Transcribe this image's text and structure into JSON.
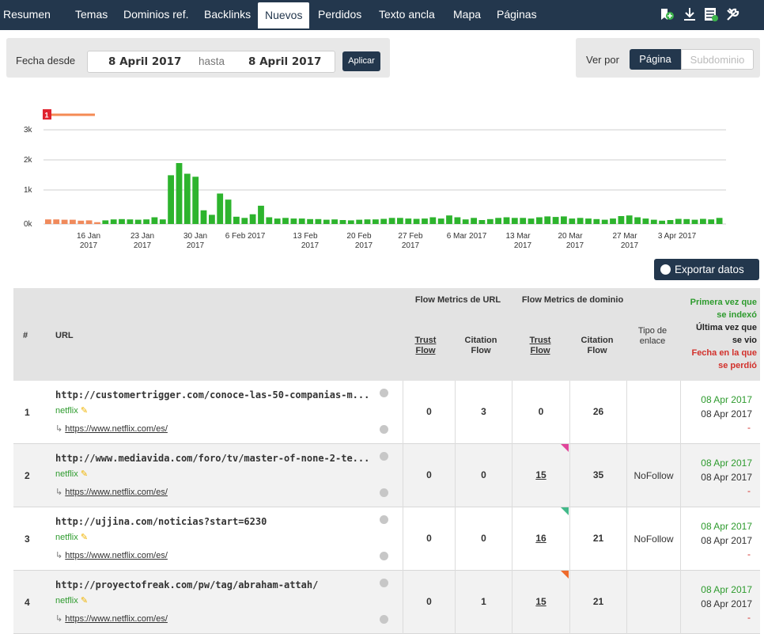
{
  "nav": {
    "tabs": [
      "Resumen",
      "Temas",
      "Dominios ref.",
      "Backlinks",
      "Nuevos",
      "Perdidos",
      "Texto ancla",
      "Mapa",
      "Páginas"
    ],
    "active": "Nuevos",
    "icons": [
      "bookmark-add-icon",
      "download-icon",
      "export-sheet-icon",
      "tools-icon"
    ]
  },
  "filter": {
    "label": "Fecha desde",
    "from": "8 April 2017",
    "to_label": "hasta",
    "to": "8 April 2017",
    "apply": "Aplicar"
  },
  "view": {
    "label": "Ver por",
    "selected": "Página",
    "other": "Subdominio"
  },
  "chart_data": {
    "type": "bar",
    "yticks": [
      "3k",
      "2k",
      "1k",
      "0k"
    ],
    "ylim": [
      0,
      3500
    ],
    "x_labels": [
      {
        "l1": "16 Jan",
        "l2": "2017"
      },
      {
        "l1": "23 Jan",
        "l2": "2017"
      },
      {
        "l1": "30 Jan",
        "l2": "2017"
      },
      {
        "l1": "6 Feb 2017",
        "l2": ""
      },
      {
        "l1": "13 Feb",
        "l2": "2017"
      },
      {
        "l1": "20 Feb",
        "l2": "2017"
      },
      {
        "l1": "27 Feb",
        "l2": "2017"
      },
      {
        "l1": "6 Mar 2017",
        "l2": ""
      },
      {
        "l1": "13 Mar",
        "l2": "2017"
      },
      {
        "l1": "20 Mar",
        "l2": "2017"
      },
      {
        "l1": "27 Mar",
        "l2": "2017"
      },
      {
        "l1": "3 Apr 2017",
        "l2": ""
      }
    ],
    "values": [
      150,
      150,
      140,
      140,
      110,
      120,
      60,
      120,
      150,
      160,
      150,
      140,
      150,
      220,
      150,
      1600,
      2000,
      1650,
      1550,
      450,
      300,
      1000,
      800,
      240,
      200,
      320,
      600,
      220,
      180,
      200,
      180,
      180,
      160,
      160,
      140,
      150,
      130,
      120,
      140,
      150,
      150,
      170,
      200,
      200,
      180,
      170,
      180,
      220,
      180,
      280,
      220,
      150,
      200,
      130,
      160,
      200,
      220,
      200,
      200,
      180,
      220,
      250,
      230,
      250,
      180,
      200,
      180,
      160,
      140,
      180,
      260,
      280,
      220,
      180,
      140,
      110,
      130,
      170,
      160,
      140,
      170,
      150,
      200
    ],
    "bar_colors": {
      "start": "#f08a5c",
      "main": "#2db42d"
    },
    "orange_count": 7,
    "legend_badge": "1",
    "legend_badge_color": "#e0232e",
    "legend_line_color": "#f48a54"
  },
  "export": {
    "label": "Exportar datos"
  },
  "table": {
    "headers": {
      "num": "#",
      "url": "URL",
      "fm_url": "Flow Metrics de URL",
      "fm_dom": "Flow Metrics de dominio",
      "tf1_a": "Trust",
      "tf1_b": "Flow",
      "cf1_a": "Citation",
      "cf1_b": "Flow",
      "tf2_a": "Trust",
      "tf2_b": "Flow",
      "cf2_a": "Citation",
      "cf2_b": "Flow",
      "tipo_a": "Tipo de",
      "tipo_b": "enlace",
      "d1_a": "Primera vez que",
      "d1_b": "se indexó",
      "d2_a": "Última vez que",
      "d2_b": "se vio",
      "d3_a": "Fecha en la que",
      "d3_b": "se perdió"
    },
    "rows": [
      {
        "n": "1",
        "url": "http://customertrigger.com/conoce-las-50-companias-m...",
        "anchor": "netflix",
        "target": "https://www.netflix.com/es/",
        "tf": "0",
        "cf": "3",
        "dtf": "0",
        "dcf": "26",
        "type": "",
        "first": "08 Apr 2017",
        "last": "08 Apr 2017",
        "lost": "-",
        "flag": ""
      },
      {
        "n": "2",
        "url": "http://www.mediavida.com/foro/tv/master-of-none-2-te...",
        "anchor": "netflix",
        "target": "https://www.netflix.com/es/",
        "tf": "0",
        "cf": "0",
        "dtf": "15",
        "dcf": "35",
        "type": "NoFollow",
        "first": "08 Apr 2017",
        "last": "08 Apr 2017",
        "lost": "-",
        "flag": "#e0459a"
      },
      {
        "n": "3",
        "url": "http://ujjina.com/noticias?start=6230",
        "anchor": "netflix",
        "target": "https://www.netflix.com/es/",
        "tf": "0",
        "cf": "0",
        "dtf": "16",
        "dcf": "21",
        "type": "NoFollow",
        "first": "08 Apr 2017",
        "last": "08 Apr 2017",
        "lost": "-",
        "flag": "#43b98a"
      },
      {
        "n": "4",
        "url": "http://proyectofreak.com/pw/tag/abraham-attah/",
        "anchor": "netflix",
        "target": "https://www.netflix.com/es/",
        "tf": "0",
        "cf": "1",
        "dtf": "15",
        "dcf": "21",
        "type": "",
        "first": "08 Apr 2017",
        "last": "08 Apr 2017",
        "lost": "-",
        "flag": "#ee6a2c"
      }
    ]
  }
}
